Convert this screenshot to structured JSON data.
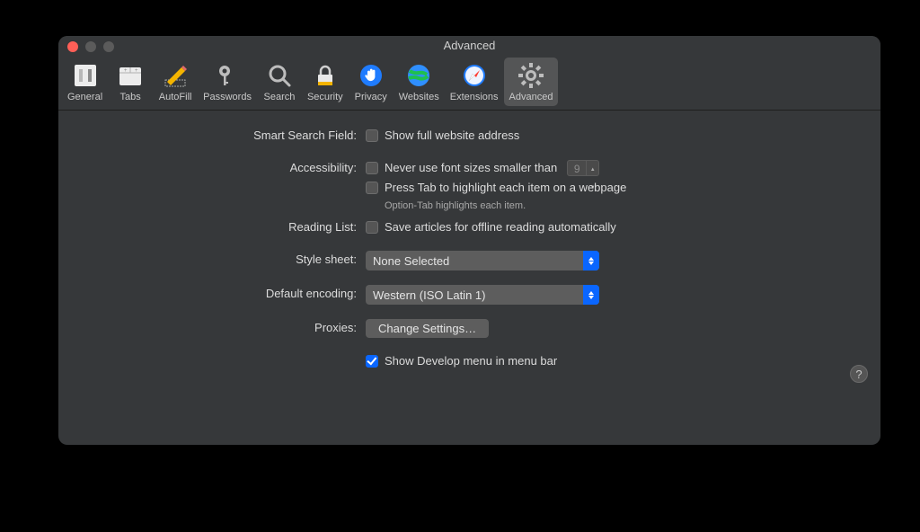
{
  "title": "Advanced",
  "toolbar": [
    {
      "id": "general",
      "label": "General"
    },
    {
      "id": "tabs",
      "label": "Tabs"
    },
    {
      "id": "autofill",
      "label": "AutoFill"
    },
    {
      "id": "passwords",
      "label": "Passwords"
    },
    {
      "id": "search",
      "label": "Search"
    },
    {
      "id": "security",
      "label": "Security"
    },
    {
      "id": "privacy",
      "label": "Privacy"
    },
    {
      "id": "websites",
      "label": "Websites"
    },
    {
      "id": "extensions",
      "label": "Extensions"
    },
    {
      "id": "advanced",
      "label": "Advanced"
    }
  ],
  "labels": {
    "smart_search": "Smart Search Field:",
    "accessibility": "Accessibility:",
    "reading_list": "Reading List:",
    "style_sheet": "Style sheet:",
    "default_encoding": "Default encoding:",
    "proxies": "Proxies:"
  },
  "options": {
    "show_full_address": "Show full website address",
    "never_font_smaller": "Never use font sizes smaller than",
    "font_size_value": "9",
    "press_tab": "Press Tab to highlight each item on a webpage",
    "press_tab_hint": "Option-Tab highlights each item.",
    "save_offline": "Save articles for offline reading automatically",
    "style_sheet_value": "None Selected",
    "encoding_value": "Western (ISO Latin 1)",
    "change_settings": "Change Settings…",
    "show_develop": "Show Develop menu in menu bar"
  },
  "help": "?"
}
